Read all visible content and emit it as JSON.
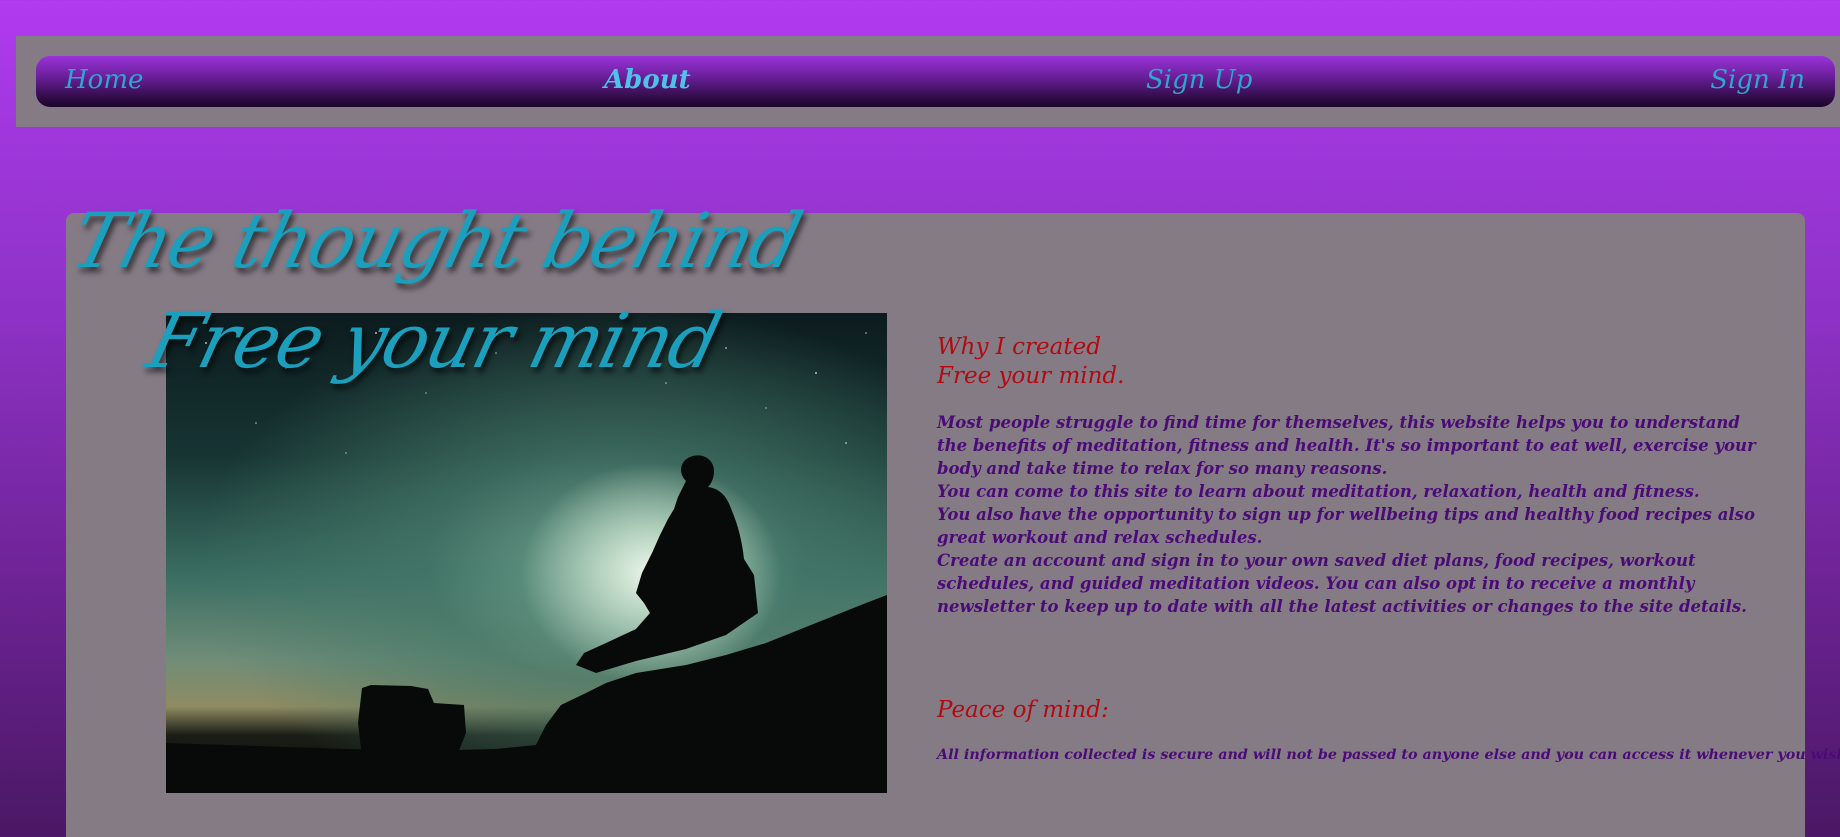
{
  "nav": {
    "home": "Home",
    "about": "About",
    "signup": "Sign Up",
    "signin": "Sign In"
  },
  "hero": {
    "line1": "The thought behind",
    "line2": "Free your mind"
  },
  "why": {
    "line1": "Why I created",
    "line2": "Free your mind."
  },
  "body": {
    "p1": "Most people struggle to find time for themselves, this website helps you to understand the benefits of meditation, fitness and health. It's so important to eat well, exercise your body and take time to relax for so many reasons.",
    "p2": "You can come to this site to learn about meditation, relaxation, health and fitness.",
    "p3": "You also have the opportunity to sign up for wellbeing tips and healthy food recipes also great workout and relax schedules.",
    "p4": "Create an account and sign in to your own saved diet plans, food recipes, workout schedules, and guided meditation videos. You can also opt in to receive a monthly newsletter to keep up to date with all the latest activities or changes to the site details."
  },
  "peace": {
    "title": "Peace of mind:",
    "text": "All information collected is secure and will not be passed to anyone else and you can access it whenever you wish."
  },
  "colors": {
    "nav_link": "#2ea6cf",
    "heading_red": "#b30a12",
    "body_purple": "#4a0b77",
    "hero_teal": "#1b9fbd",
    "panel_gray": "#857b85"
  }
}
